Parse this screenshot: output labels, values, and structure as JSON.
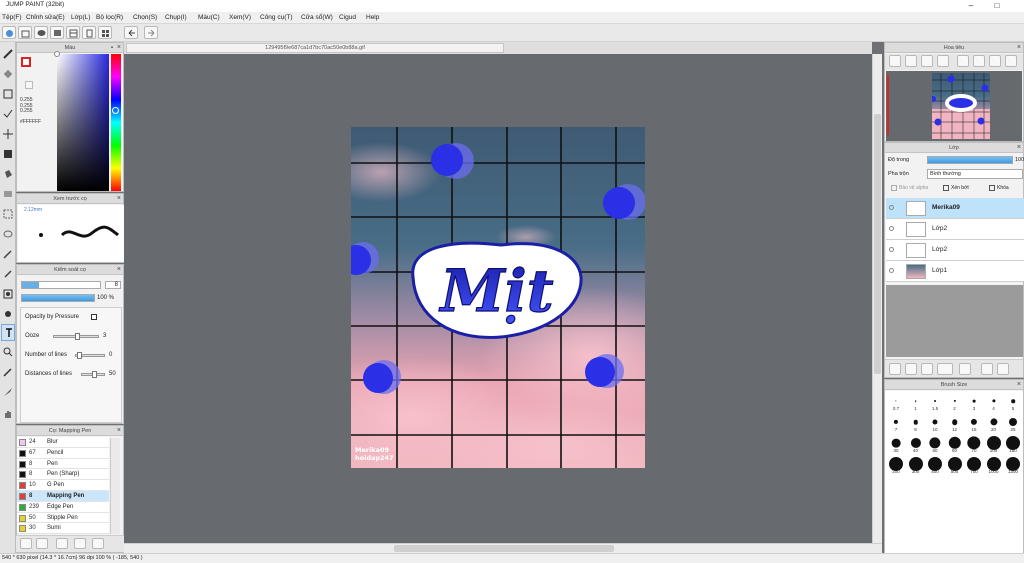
{
  "window": {
    "title": "JUMP PAINT (32bit)",
    "minimize": "–",
    "maximize": "□"
  },
  "menu": [
    "Tệp(F)",
    "Chỉnh sửa(E)",
    "Lớp(L)",
    "Bộ lọc(R)",
    "Chọn(S)",
    "Chụp(I)",
    "Màu(C)",
    "Xem(V)",
    "Công cụ(T)",
    "Cửa sổ(W)",
    "Cigud",
    "Help"
  ],
  "file_tab": "129495f9e687ca1d7bc70ac50e0b88a.gif",
  "color_panel": {
    "title": "Màu",
    "values": [
      "0.255",
      "0.255",
      "0.255",
      "#FFFFFF"
    ]
  },
  "preview_panel": {
    "title": "Xem trước cọ",
    "size": "2.12mm"
  },
  "brush_settings": {
    "title": "Kiểm soát cọ",
    "size_value": "8",
    "opacity_value": "100 %",
    "opacity_fraction": 1.0,
    "size_fraction": 0.22,
    "opacity_by_pressure": "Opacity by Pressure",
    "ooze_label": "Ooze",
    "ooze_value": "3",
    "ooze_fraction": 0.5,
    "lines_label": "Number of lines",
    "lines_value": "0",
    "lines_fraction": 0.05,
    "distance_label": "Distances of lines",
    "distance_value": "50",
    "distance_fraction": 0.5
  },
  "brush_list": {
    "title": "Cọ: Mapping Pen",
    "items": [
      {
        "num": "24",
        "name": "Blur",
        "color": "#f3c6ee"
      },
      {
        "num": "67",
        "name": "Pencil",
        "color": "#111111"
      },
      {
        "num": "8",
        "name": "Pen",
        "color": "#111111"
      },
      {
        "num": "8",
        "name": "Pen (Sharp)",
        "color": "#111111"
      },
      {
        "num": "10",
        "name": "G Pen",
        "color": "#e0403a"
      },
      {
        "num": "8",
        "name": "Mapping Pen",
        "color": "#e0403a"
      },
      {
        "num": "239",
        "name": "Edge Pen",
        "color": "#2cae3a"
      },
      {
        "num": "50",
        "name": "Stipple Pen",
        "color": "#e3d22f"
      },
      {
        "num": "30",
        "name": "Sumi",
        "color": "#e3d22f"
      }
    ]
  },
  "artwork": {
    "title_text": "Mịt",
    "credit_line1": "Merika09",
    "credit_line2": "hoidap247"
  },
  "navigator": {
    "title": "Hoa tiêu"
  },
  "layer_panel": {
    "title": "Lớp",
    "opacity_label": "Độ trong",
    "opacity_value": "100",
    "blend_label": "Pha trộn",
    "blend_value": "Bình thường",
    "protect_alpha": "Bảo vệ alpha",
    "clip": "Xén bớt",
    "lock": "Khóa",
    "layers": [
      {
        "name": "Merika09",
        "selected": true
      },
      {
        "name": "Lớp2",
        "selected": false
      },
      {
        "name": "Lớp2",
        "selected": false
      },
      {
        "name": "Lớp1",
        "selected": false
      }
    ]
  },
  "brush_size_panel": {
    "title": "Brush Size",
    "sizes": [
      "0.7",
      "1",
      "1.5",
      "2",
      "3",
      "4",
      "5",
      "7",
      "8",
      "10",
      "12",
      "15",
      "20",
      "25",
      "30",
      "40",
      "50",
      "60",
      "70",
      "100",
      "150",
      "200",
      "300",
      "400",
      "500",
      "700",
      "1000",
      "1300"
    ]
  },
  "status": "540 * 630 pixel  (14.3 * 16.7cm)  96 dpi  100 %  ( -185, 540 )"
}
